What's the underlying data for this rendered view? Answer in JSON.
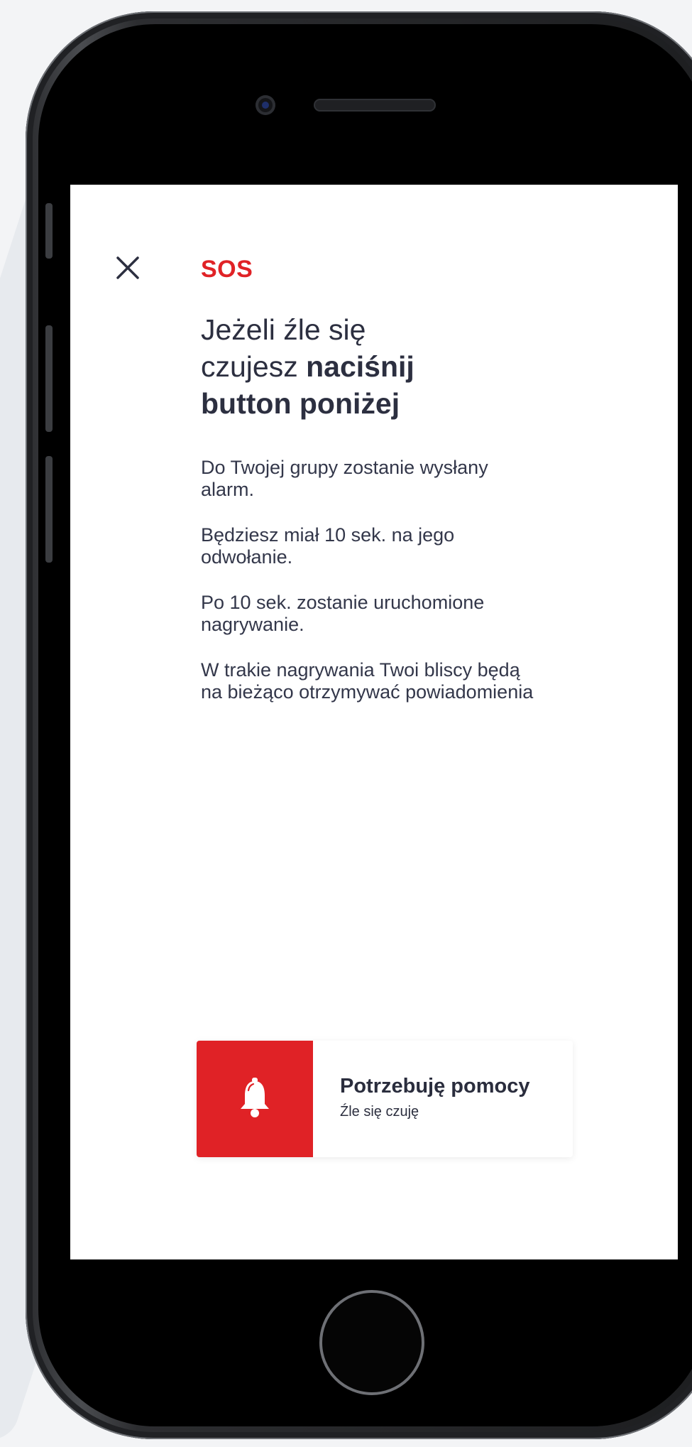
{
  "header": {
    "title": "SOS"
  },
  "headline": {
    "part1": "Jeżeli źle się",
    "part2": "czujesz ",
    "part3": "naciśnij",
    "part4": "button poniżej"
  },
  "body": {
    "paragraphs": [
      "Do Twojej grupy zostanie wysłany alarm.",
      "Będziesz miał 10 sek. na jego odwołanie.",
      "Po 10 sek. zostanie uruchomione nagrywanie.",
      "W trakie nagrywania Twoi bliscy będą na bieżąco otrzymywać powiadomienia"
    ]
  },
  "sos_button": {
    "title": "Potrzebuję pomocy",
    "subtitle": "Źle się czuję",
    "icon": "bell-icon"
  },
  "colors": {
    "accent": "#e02226",
    "text": "#2c2f40",
    "background": "#ffffff"
  }
}
